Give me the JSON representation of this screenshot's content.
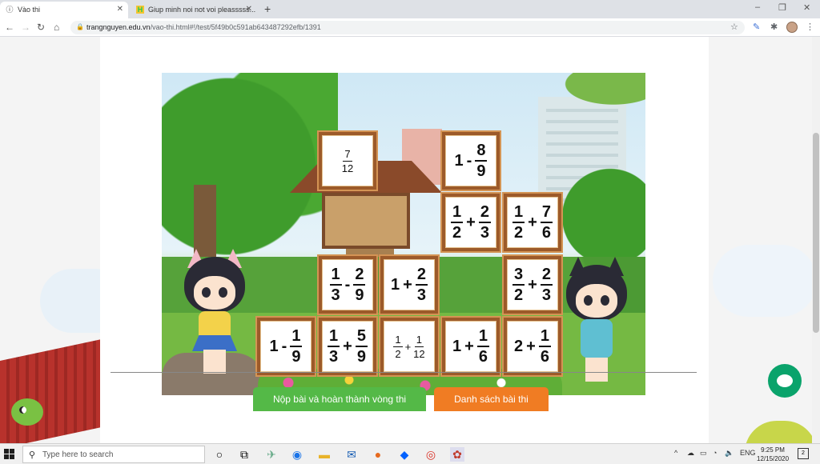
{
  "browser": {
    "tabs": [
      {
        "title": "Vào thi",
        "active": true
      },
      {
        "title": "Giup minh noi not voi pleasssss...",
        "active": false
      }
    ],
    "new_tab": "+",
    "url_host": "trangnguyen.edu.vn",
    "url_path": "/vao-thi.html#!/test/5f49b0c591ab643487292efb/1391",
    "window_controls": [
      "–",
      "❐",
      "✕"
    ]
  },
  "game": {
    "tiles": [
      {
        "id": "t1",
        "parts": [
          {
            "frac": [
              "7",
              "12"
            ]
          }
        ],
        "small": true
      },
      {
        "id": "t2",
        "parts": [
          {
            "t": "1"
          },
          {
            "op": "-"
          },
          {
            "frac": [
              "8",
              "9"
            ]
          }
        ]
      },
      {
        "id": "t3",
        "parts": [
          {
            "frac": [
              "1",
              "2"
            ]
          },
          {
            "op": "+"
          },
          {
            "frac": [
              "2",
              "3"
            ]
          }
        ]
      },
      {
        "id": "t4",
        "parts": [
          {
            "frac": [
              "1",
              "2"
            ]
          },
          {
            "op": "+"
          },
          {
            "frac": [
              "7",
              "6"
            ]
          }
        ]
      },
      {
        "id": "t5",
        "parts": [
          {
            "frac": [
              "1",
              "3"
            ]
          },
          {
            "op": "-"
          },
          {
            "frac": [
              "2",
              "9"
            ]
          }
        ]
      },
      {
        "id": "t6",
        "parts": [
          {
            "t": "1"
          },
          {
            "op": "+"
          },
          {
            "frac": [
              "2",
              "3"
            ]
          }
        ]
      },
      {
        "id": "t7",
        "parts": [
          {
            "frac": [
              "3",
              "2"
            ]
          },
          {
            "op": "+"
          },
          {
            "frac": [
              "2",
              "3"
            ]
          }
        ]
      },
      {
        "id": "t8",
        "parts": [
          {
            "t": "1"
          },
          {
            "op": "-"
          },
          {
            "frac": [
              "1",
              "9"
            ]
          }
        ]
      },
      {
        "id": "t9",
        "parts": [
          {
            "frac": [
              "1",
              "3"
            ]
          },
          {
            "op": "+"
          },
          {
            "frac": [
              "5",
              "9"
            ]
          }
        ]
      },
      {
        "id": "t10",
        "parts": [
          {
            "frac": [
              "1",
              "2"
            ]
          },
          {
            "op": "+"
          },
          {
            "frac": [
              "1",
              "12"
            ]
          }
        ],
        "small": true
      },
      {
        "id": "t11",
        "parts": [
          {
            "t": "1"
          },
          {
            "op": "+"
          },
          {
            "frac": [
              "1",
              "6"
            ]
          }
        ]
      },
      {
        "id": "t12",
        "parts": [
          {
            "t": "2"
          },
          {
            "op": "+"
          },
          {
            "frac": [
              "1",
              "6"
            ]
          }
        ]
      }
    ]
  },
  "actions": {
    "submit_label": "Nộp bài và hoàn thành vòng thi",
    "list_label": "Danh sách bài thi"
  },
  "taskbar": {
    "search_placeholder": "Type here to search",
    "language": "ENG",
    "time": "9:25 PM",
    "date": "12/15/2020",
    "notifications": "2"
  },
  "colors": {
    "submit": "#54b947",
    "list": "#f07c23",
    "tile_border": "#9c5a2a",
    "chat": "#0aa36b"
  }
}
